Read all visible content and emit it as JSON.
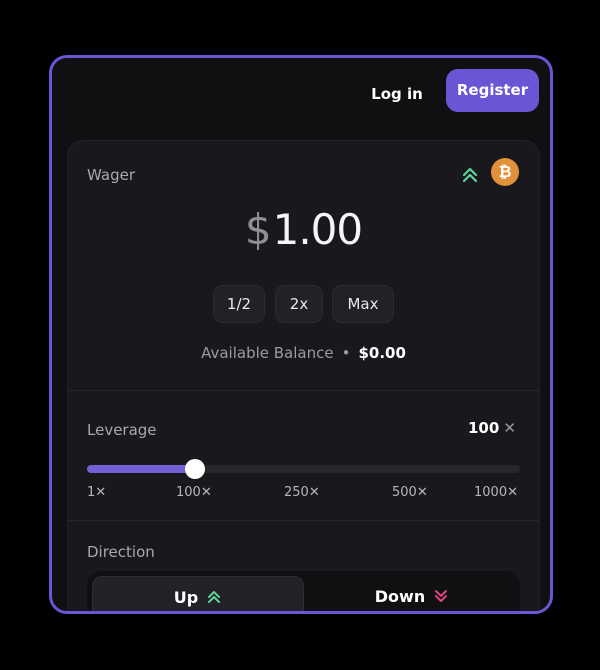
{
  "header": {
    "login_label": "Log in",
    "register_label": "Register"
  },
  "wager": {
    "label": "Wager",
    "currency_symbol": "$",
    "amount": "1.00",
    "coin_icon": "bitcoin-icon",
    "coin_glyph": "₿",
    "quick_buttons": [
      "1/2",
      "2x",
      "Max"
    ],
    "balance_label": "Available Balance",
    "balance_separator": "•",
    "balance_value": "$0.00"
  },
  "leverage": {
    "label": "Leverage",
    "value": "100",
    "unit": "✕",
    "slider_fraction": 0.25,
    "ticks": [
      "1✕",
      "100✕",
      "250✕",
      "500✕",
      "1000✕"
    ]
  },
  "direction": {
    "label": "Direction",
    "options": [
      {
        "label": "Up",
        "icon": "chevron-double-up-icon",
        "color": "#5fd39a",
        "selected": true
      },
      {
        "label": "Down",
        "icon": "chevron-double-down-icon",
        "color": "#e0457b",
        "selected": false
      }
    ]
  },
  "colors": {
    "accent": "#6a56d4",
    "up": "#5fd39a",
    "down": "#e0457b",
    "bitcoin": "#e2913b"
  }
}
